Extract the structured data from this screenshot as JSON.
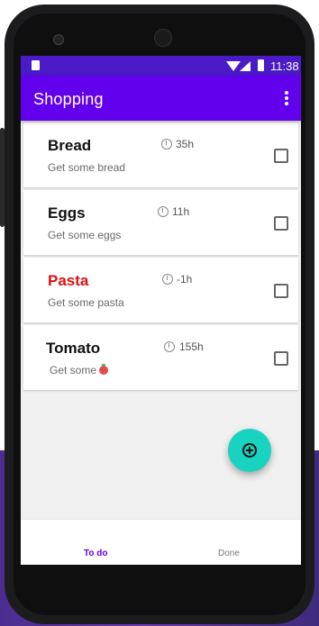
{
  "status_bar": {
    "time": "11:38"
  },
  "app_bar": {
    "title": "Shopping",
    "menu_icon": "more-vert-icon"
  },
  "items": [
    {
      "name": "Bread",
      "description": "Get some bread",
      "time": "35h",
      "overdue": false
    },
    {
      "name": "Eggs",
      "description": "Get some eggs",
      "time": "11h",
      "overdue": false
    },
    {
      "name": "Pasta",
      "description": "Get some pasta",
      "time": "-1h",
      "overdue": true
    },
    {
      "name": "Tomato",
      "description": "Get some",
      "description_icon": "tomato-icon",
      "time": "155h",
      "overdue": false
    }
  ],
  "fab": {
    "icon": "add-circle-icon"
  },
  "tabs": [
    {
      "label": "To do",
      "active": true
    },
    {
      "label": "Done",
      "active": false
    }
  ],
  "colors": {
    "status_bar": "#4a19c8",
    "app_bar": "#6200ee",
    "fab": "#18d3c0",
    "overdue": "#e01010",
    "active_tab": "#6200ee"
  }
}
